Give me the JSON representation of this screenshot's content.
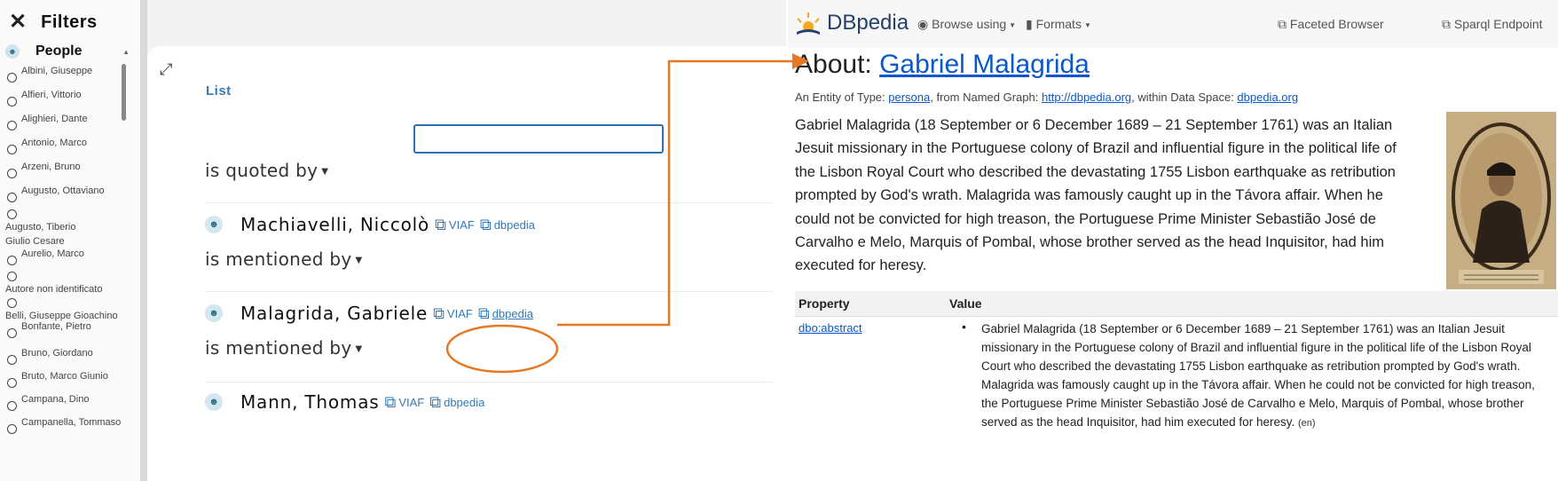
{
  "sidebar": {
    "title": "Filters",
    "close_icon": "close-icon",
    "section_label": "People",
    "items": [
      "Albini, Giuseppe",
      "Alfieri, Vittorio",
      "Alighieri, Dante",
      "Antonio, Marco",
      "Arzeni, Bruno",
      "Augusto, Ottaviano",
      "Augusto, Tiberio Giulio Cesare",
      "Aurelio, Marco",
      "Autore non identificato",
      "Belli, Giuseppe Gioachino",
      "Bonfante, Pietro",
      "Bruno, Giordano",
      "Bruto, Marco Giunio",
      "Campana, Dino",
      "Campanella, Tommaso"
    ]
  },
  "list_panel": {
    "tab_label": "List",
    "search_value": "",
    "relations": [
      "is quoted by",
      "is mentioned by",
      "is mentioned by"
    ],
    "people": [
      {
        "name": "Machiavelli, Niccolò",
        "viaf": "VIAF",
        "dbpedia": "dbpedia"
      },
      {
        "name": "Malagrida, Gabriele",
        "viaf": "VIAF",
        "dbpedia": "dbpedia"
      },
      {
        "name": "Mann, Thomas",
        "viaf": "VIAF",
        "dbpedia": "dbpedia"
      }
    ]
  },
  "annotation": {
    "color": "#e87722"
  },
  "dbpedia": {
    "logo_text": "DBpedia",
    "nav": {
      "browse": "Browse using",
      "formats": "Formats",
      "faceted": "Faceted Browser",
      "sparql": "Sparql Endpoint"
    },
    "about_prefix": "About: ",
    "about_entity": "Gabriel Malagrida",
    "entity": {
      "prefix": "An Entity of Type: ",
      "type": "persona",
      "mid1": ", from Named Graph: ",
      "graph": "http://dbpedia.org",
      "mid2": ", within Data Space: ",
      "space": "dbpedia.org"
    },
    "abstract": "Gabriel Malagrida (18 September or 6 December 1689 – 21 September 1761) was an Italian Jesuit missionary in the Portuguese colony of Brazil and influential figure in the political life of the Lisbon Royal Court who described the devastating 1755 Lisbon earthquake as retribution prompted by God's wrath. Malagrida was famously caught up in the Távora affair. When he could not be convicted for high treason, the Portuguese Prime Minister Sebastião José de Carvalho e Melo, Marquis of Pombal, whose brother served as the head Inquisitor, had him executed for heresy.",
    "table": {
      "property_header": "Property",
      "value_header": "Value",
      "property": "dbo:abstract",
      "value": "Gabriel Malagrida (18 September or 6 December 1689 – 21 September 1761) was an Italian Jesuit missionary in the Portuguese colony of Brazil and influential figure in the political life of the Lisbon Royal Court who described the devastating 1755 Lisbon earthquake as retribution prompted by God's wrath. Malagrida was famously caught up in the Távora affair. When he could not be convicted for high treason, the Portuguese Prime Minister Sebastião José de Carvalho e Melo, Marquis of Pombal, whose brother served as the head Inquisitor, had him executed for heresy.",
      "lang": "(en)"
    }
  }
}
